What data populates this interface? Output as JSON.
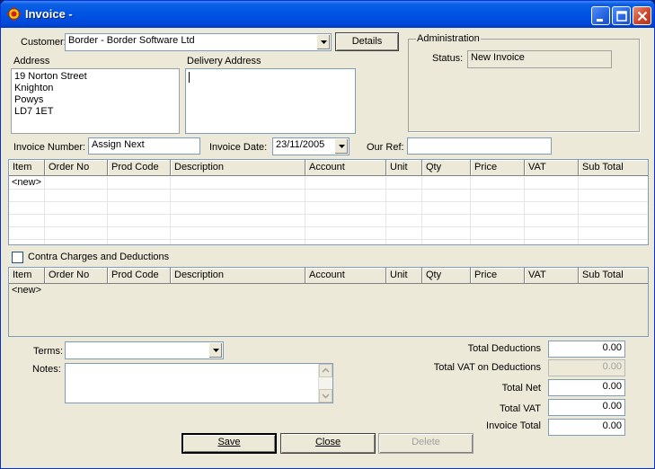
{
  "window": {
    "title": "Invoice -"
  },
  "customer": {
    "label": "Customer:",
    "value": "Border - Border Software Ltd",
    "details_label": "Details"
  },
  "address": {
    "label": "Address",
    "lines": "19 Norton Street\nKnighton\nPowys\nLD7 1ET"
  },
  "delivery_address": {
    "label": "Delivery Address",
    "value": ""
  },
  "administration": {
    "title": "Administration",
    "status_label": "Status:",
    "status_value": "New Invoice"
  },
  "invoice_number": {
    "label": "Invoice Number:",
    "value": "Assign Next"
  },
  "invoice_date": {
    "label": "Invoice Date:",
    "value": "23/11/2005"
  },
  "our_ref": {
    "label": "Our Ref:",
    "value": ""
  },
  "columns": [
    "Item",
    "Order No",
    "Prod Code",
    "Description",
    "Account",
    "Unit",
    "Qty",
    "Price",
    "VAT",
    "Sub Total"
  ],
  "lines_grid": {
    "rows": [
      [
        "<new>",
        "",
        "",
        "",
        "",
        "",
        "",
        "",
        "",
        ""
      ]
    ]
  },
  "contra": {
    "label": "Contra Charges and Deductions",
    "checked": false
  },
  "contra_grid": {
    "rows": [
      [
        "<new>",
        "",
        "",
        "",
        "",
        "",
        "",
        "",
        "",
        ""
      ]
    ]
  },
  "terms": {
    "label": "Terms:",
    "value": ""
  },
  "notes": {
    "label": "Notes:",
    "value": ""
  },
  "totals": {
    "total_deductions": {
      "label": "Total Deductions",
      "value": "0.00"
    },
    "total_vat_on_deductions": {
      "label": "Total VAT on Deductions",
      "value": "0.00"
    },
    "total_net": {
      "label": "Total Net",
      "value": "0.00"
    },
    "total_vat": {
      "label": "Total VAT",
      "value": "0.00"
    },
    "invoice_total": {
      "label": "Invoice Total",
      "value": "0.00"
    }
  },
  "buttons": {
    "save": "Save",
    "close": "Close",
    "delete": "Delete"
  }
}
